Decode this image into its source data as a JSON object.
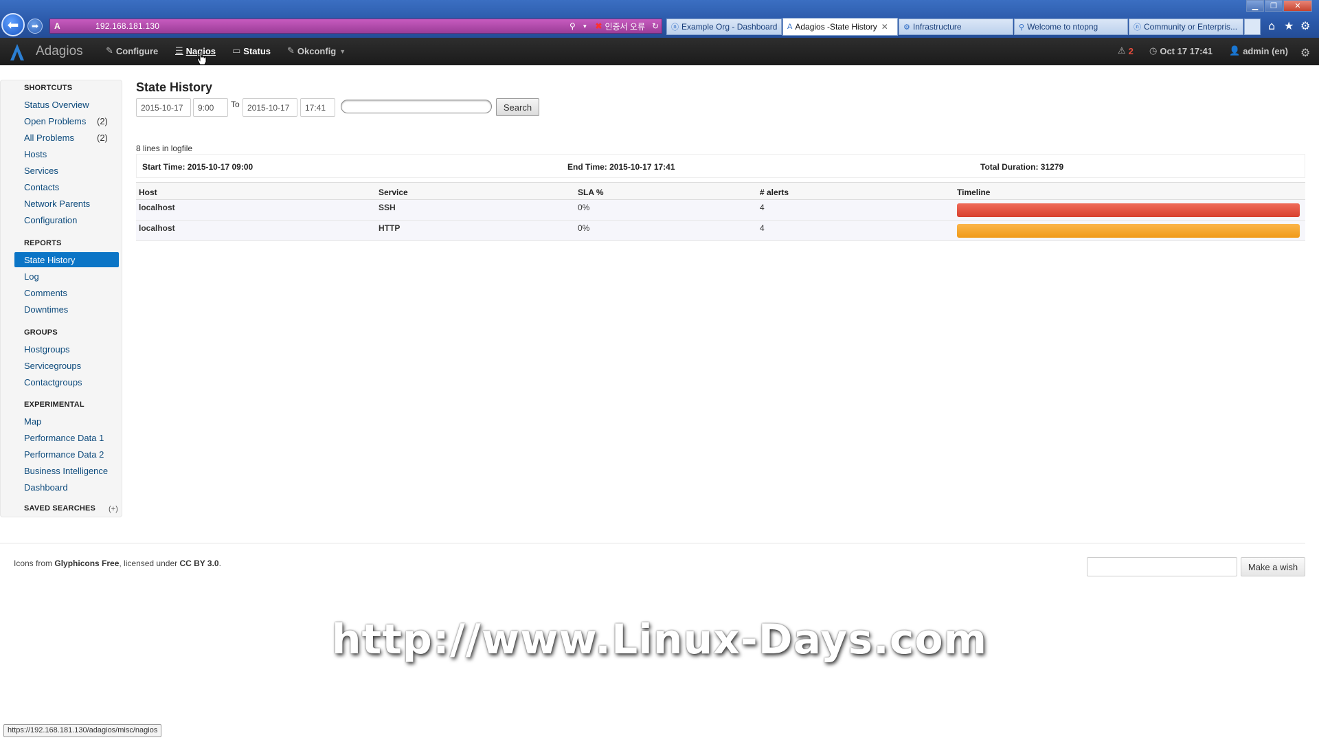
{
  "browser": {
    "url": "192.168.181.130",
    "cert_error": "인증서 오류",
    "tabs": [
      {
        "label": "Example Org - Dashboard",
        "icon": "ntop-icon"
      },
      {
        "label": "Adagios -State History",
        "icon": "adagios-icon",
        "active": true
      },
      {
        "label": "Infrastructure",
        "icon": "infra-icon"
      },
      {
        "label": "Welcome to ntopng",
        "icon": "search-icon"
      },
      {
        "label": "Community or Enterpris...",
        "icon": "ntop-icon"
      }
    ],
    "status_url": "https://192.168.181.130/adagios/misc/nagios"
  },
  "navbar": {
    "brand": "Adagios",
    "items": {
      "configure": "Configure",
      "nagios": "Nagios",
      "status": "Status",
      "okconfig": "Okconfig"
    },
    "alerts_count": "2",
    "datetime": "Oct 17 17:41",
    "user": "admin (en)"
  },
  "sidebar": {
    "shortcuts_header": "SHORTCUTS",
    "shortcuts": [
      {
        "label": "Status Overview"
      },
      {
        "label": "Open Problems",
        "count": "(2)"
      },
      {
        "label": "All Problems",
        "count": "(2)"
      },
      {
        "label": "Hosts"
      },
      {
        "label": "Services"
      },
      {
        "label": "Contacts"
      },
      {
        "label": "Network Parents"
      },
      {
        "label": "Configuration"
      }
    ],
    "reports_header": "REPORTS",
    "reports": [
      "State History",
      "Log",
      "Comments",
      "Downtimes"
    ],
    "groups_header": "GROUPS",
    "groups": [
      "Hostgroups",
      "Servicegroups",
      "Contactgroups"
    ],
    "experimental_header": "EXPERIMENTAL",
    "experimental": [
      "Map",
      "Performance Data 1",
      "Performance Data 2",
      "Business Intelligence",
      "Dashboard"
    ],
    "saved_searches_header": "SAVED SEARCHES",
    "saved_searches_add": "(+)"
  },
  "main": {
    "title": "State History",
    "form": {
      "start_date": "2015-10-17",
      "start_time": "9:00",
      "to_label": "To",
      "end_date": "2015-10-17",
      "end_time": "17:41",
      "search_value": "",
      "search_button": "Search"
    },
    "logfile_lines": "8 lines in logfile",
    "summary": {
      "start": "Start Time: 2015-10-17 09:00",
      "end": "End Time: 2015-10-17 17:41",
      "duration": "Total Duration: 31279"
    },
    "table": {
      "headers": [
        "Host",
        "Service",
        "SLA %",
        "# alerts",
        "Timeline"
      ],
      "rows": [
        {
          "host": "localhost",
          "service": "SSH",
          "sla": "0%",
          "alerts": "4",
          "state": "critical",
          "color": "#d8402e"
        },
        {
          "host": "localhost",
          "service": "HTTP",
          "sla": "0%",
          "alerts": "4",
          "state": "warning",
          "color": "#f09a18"
        }
      ]
    }
  },
  "footer": {
    "prefix": "Icons from ",
    "glyphicons": "Glyphicons Free",
    "middle": ", licensed under ",
    "license": "CC BY 3.0",
    "suffix": ".",
    "wish_button": "Make a wish"
  },
  "watermark": "http://www.Linux-Days.com",
  "colors": {
    "accent": "#0b75c6",
    "navbar": "#1b1b1b",
    "critical": "#d8402e",
    "warning": "#f09a18"
  }
}
